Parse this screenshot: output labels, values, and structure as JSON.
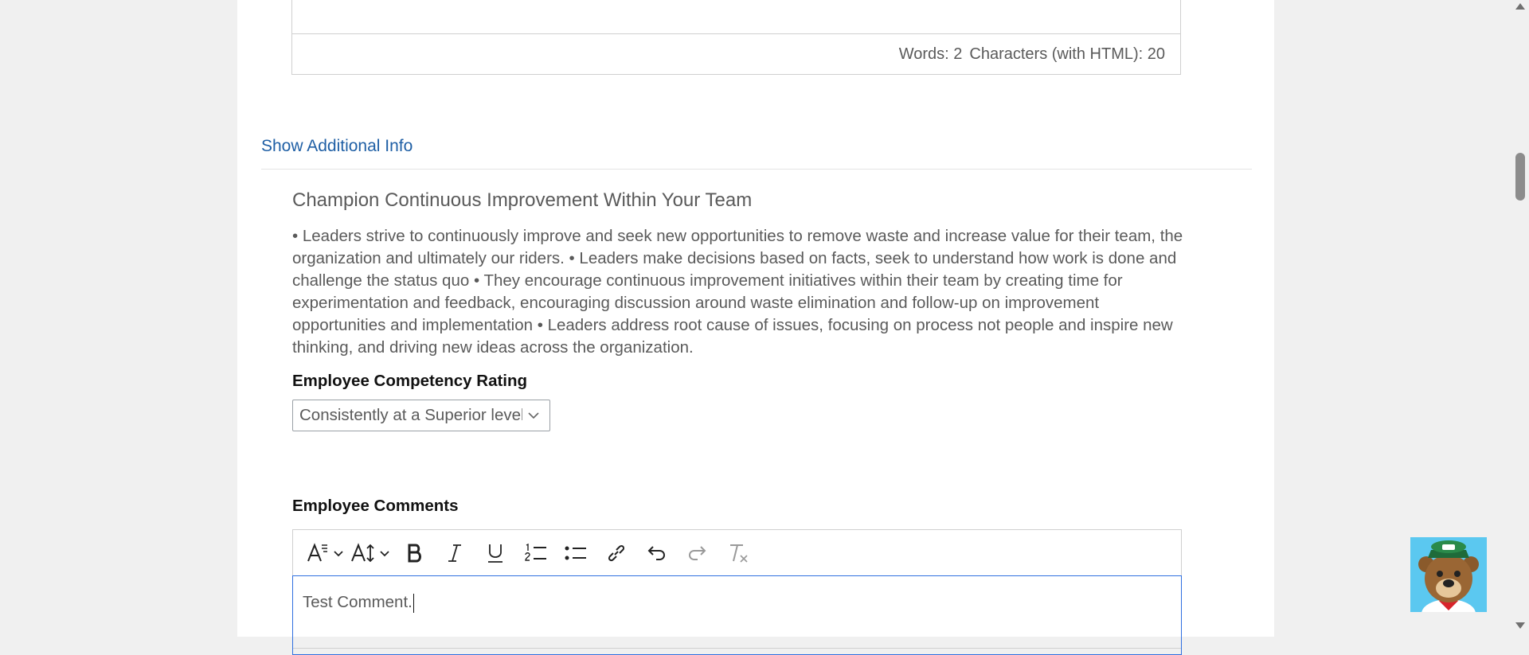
{
  "prev_editor": {
    "words": "Words: 2",
    "characters": "Characters (with HTML): 20"
  },
  "show_additional_info": "Show Additional Info",
  "competency": {
    "title": "Champion Continuous Improvement Within Your Team",
    "description": "• Leaders strive to continuously improve and seek new opportunities to remove waste and increase value for their team, the organization and ultimately our riders. • Leaders make decisions based on facts, seek to understand how work is done and challenge the status quo • They encourage continuous improvement initiatives within their team by creating time for experimentation and feedback, encouraging discussion around waste elimination and follow-up on improvement opportunities and implementation • Leaders address root cause of issues, focusing on process not people and inspire new thinking, and driving new ideas across the organization."
  },
  "rating": {
    "label": "Employee Competency Rating",
    "selected": "Consistently at a Superior level"
  },
  "comments": {
    "label": "Employee Comments",
    "content": "Test Comment.",
    "toolbar": [
      "font-style-icon",
      "font-size-icon",
      "bold-icon",
      "italic-icon",
      "underline-icon",
      "ordered-list-icon",
      "bullet-list-icon",
      "link-icon",
      "undo-icon",
      "redo-icon",
      "clear-format-icon"
    ]
  },
  "colors": {
    "link": "#1f5fa5",
    "focus_border": "#2f6fe0",
    "mascot_bg": "#5bc8f0"
  }
}
